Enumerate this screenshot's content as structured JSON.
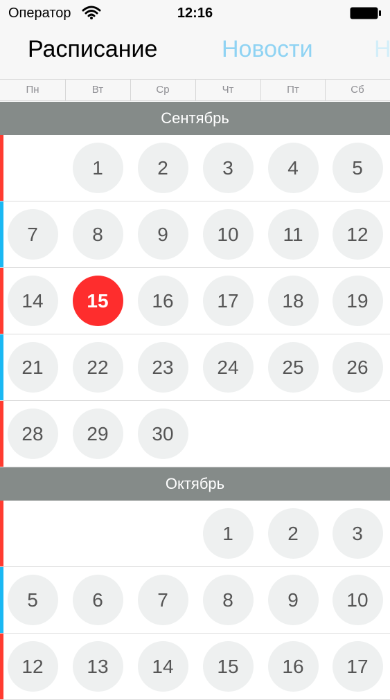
{
  "status_bar": {
    "carrier": "Оператор",
    "time": "12:16"
  },
  "nav": {
    "tabs": [
      "Расписание",
      "Новости",
      "Н"
    ]
  },
  "weekdays": [
    "Пн",
    "Вт",
    "Ср",
    "Чт",
    "Пт",
    "Сб"
  ],
  "months": [
    {
      "name": "Сентябрь",
      "weeks": [
        {
          "stripe": "red",
          "days": [
            "",
            "1",
            "2",
            "3",
            "4",
            "5"
          ]
        },
        {
          "stripe": "blue",
          "days": [
            "7",
            "8",
            "9",
            "10",
            "11",
            "12"
          ]
        },
        {
          "stripe": "red",
          "days": [
            "14",
            "15",
            "16",
            "17",
            "18",
            "19"
          ],
          "today_index": 1
        },
        {
          "stripe": "blue",
          "days": [
            "21",
            "22",
            "23",
            "24",
            "25",
            "26"
          ]
        },
        {
          "stripe": "red",
          "days": [
            "28",
            "29",
            "30",
            "",
            "",
            ""
          ]
        }
      ]
    },
    {
      "name": "Октябрь",
      "weeks": [
        {
          "stripe": "red",
          "days": [
            "",
            "",
            "",
            "1",
            "2",
            "3"
          ]
        },
        {
          "stripe": "blue",
          "days": [
            "5",
            "6",
            "7",
            "8",
            "9",
            "10"
          ]
        },
        {
          "stripe": "red",
          "days": [
            "12",
            "13",
            "14",
            "15",
            "16",
            "17"
          ]
        }
      ]
    }
  ],
  "colors": {
    "today": "#fe2d2d",
    "week_odd": "#ff3b30",
    "week_even": "#1ab8f3",
    "month_header": "#858b89"
  }
}
